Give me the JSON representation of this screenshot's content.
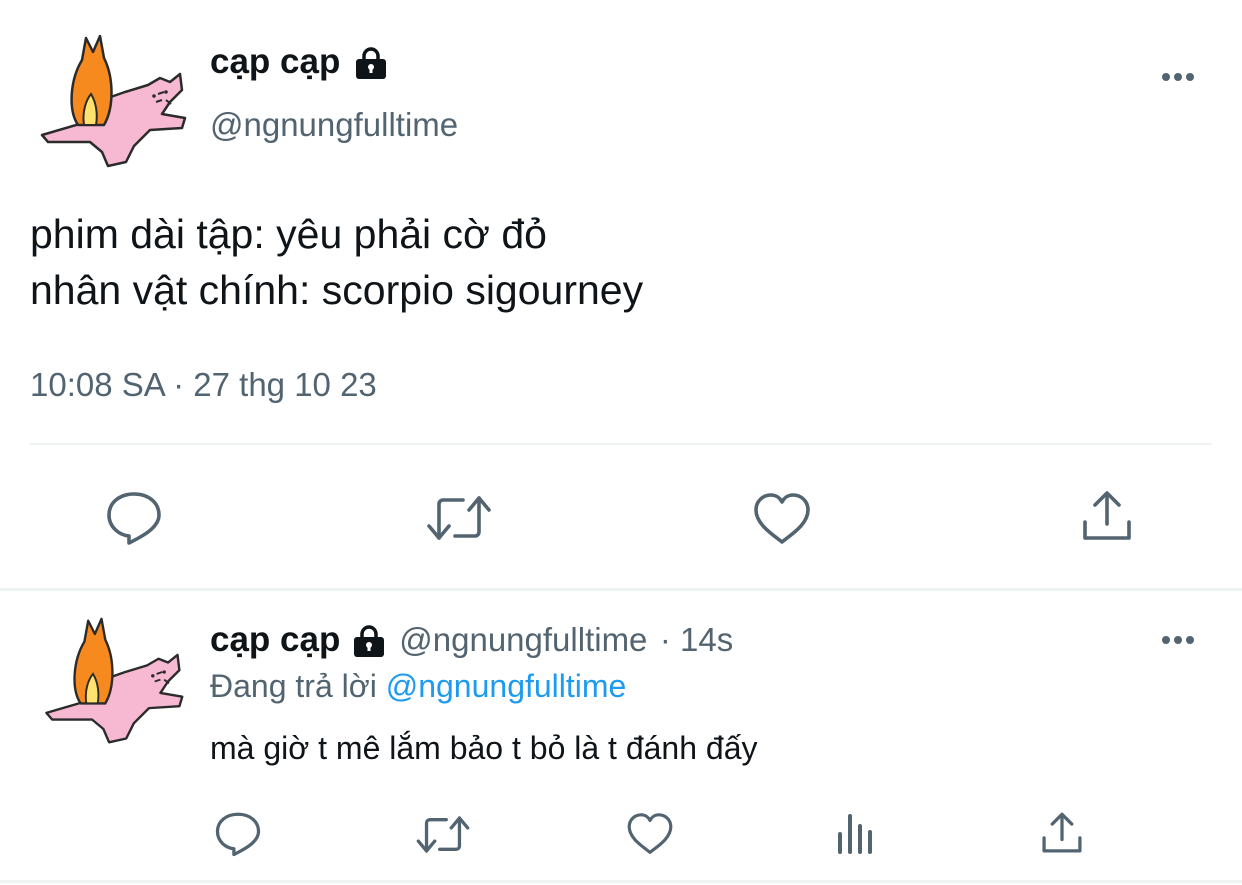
{
  "tweet": {
    "author": {
      "name": "cạp cạp",
      "handle": "@ngnungfulltime"
    },
    "text_lines": [
      "phim dài tập: yêu phải cờ đỏ",
      "nhân vật chính: scorpio sigourney"
    ],
    "timestamp": "10:08 SA · 27 thg 10 23"
  },
  "reply": {
    "author": {
      "name": "cạp cạp",
      "handle": "@ngnungfulltime"
    },
    "time": "· 14s",
    "replying_prefix": "Đang trả lời ",
    "replying_to": "@ngnungfulltime",
    "text": "mà giờ t mê lắm bảo t bỏ là t đánh đấy"
  },
  "colors": {
    "text_primary": "#0f1419",
    "text_secondary": "#536471",
    "accent": "#1d9bf0",
    "divider": "#eff3f4"
  },
  "icons": {
    "tweet_actions": [
      "reply-icon",
      "retweet-icon",
      "like-icon",
      "share-icon"
    ],
    "reply_actions": [
      "reply-icon",
      "retweet-icon",
      "like-icon",
      "analytics-icon",
      "share-icon"
    ]
  }
}
